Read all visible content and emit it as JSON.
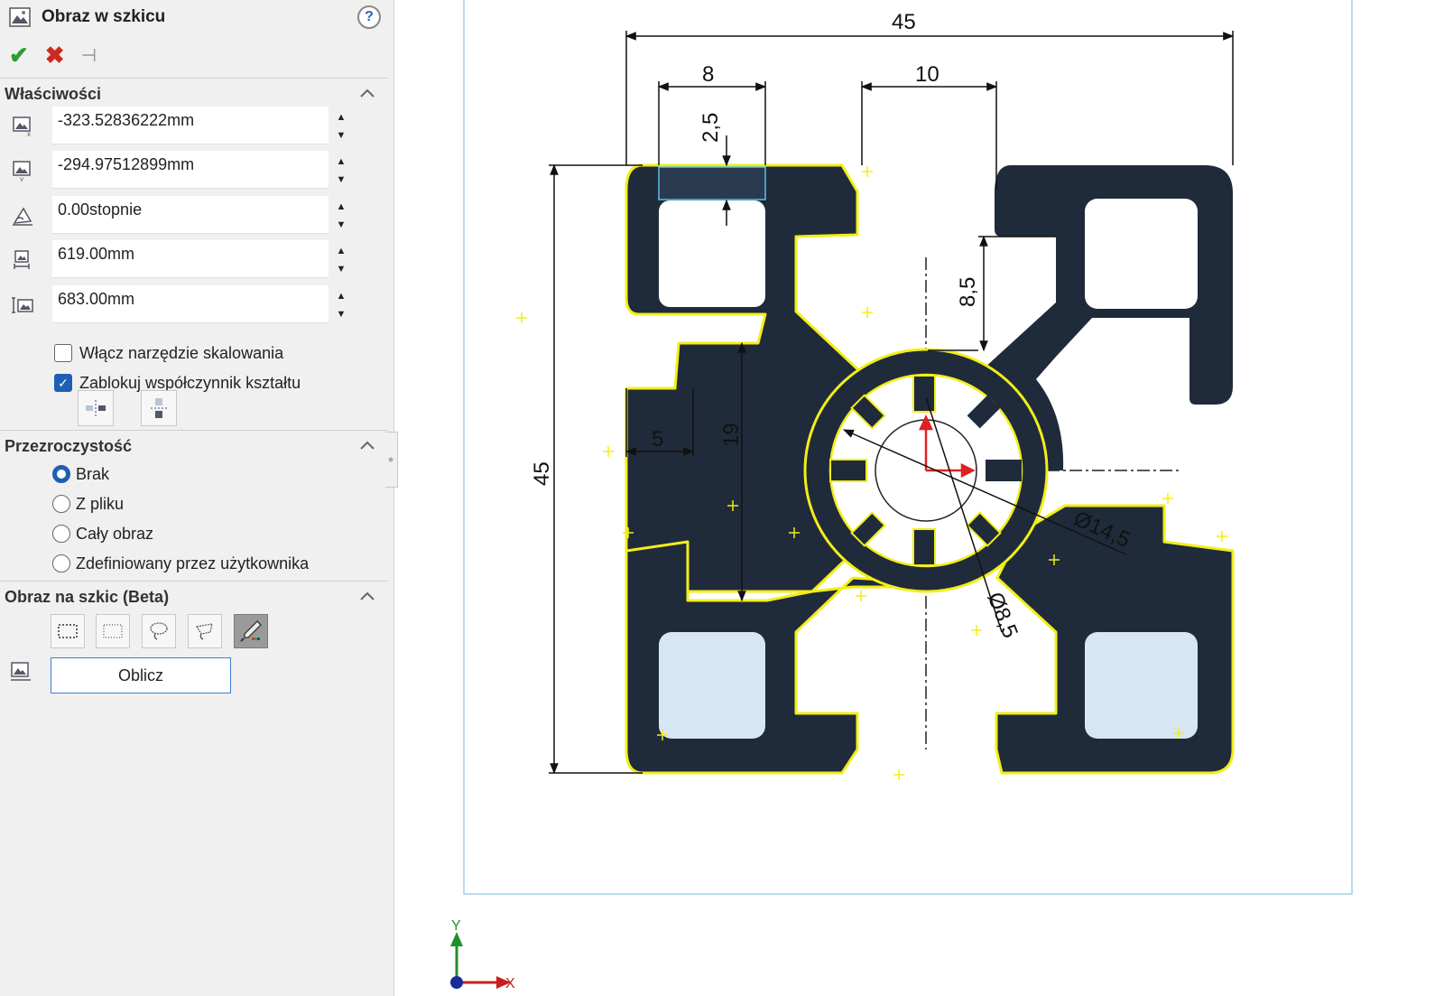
{
  "panel": {
    "title": "Obraz w szkicu",
    "help": "?",
    "sections": {
      "properties": "Właściwości",
      "transparency": "Przezroczystość",
      "image_to_sketch": "Obraz na szkic (Beta)"
    }
  },
  "properties": {
    "x_position": "-323.52836222mm",
    "y_position": "-294.97512899mm",
    "angle": "0.00stopnie",
    "width": "619.00mm",
    "height": "683.00mm",
    "enable_scale_tool": {
      "label": "Włącz narzędzie skalowania",
      "checked": false
    },
    "lock_aspect_ratio": {
      "label": "Zablokuj współczynnik kształtu",
      "checked": true
    }
  },
  "transparency": {
    "options": [
      "Brak",
      "Z pliku",
      "Cały obraz",
      "Zdefiniowany przez użytkownika"
    ],
    "selected": "Brak"
  },
  "image_to_sketch": {
    "tools": [
      "box-select-icon",
      "rect-select-icon",
      "lasso-icon",
      "poly-lasso-icon",
      "color-picker-icon"
    ],
    "active_tool": "color-picker-icon",
    "calculate_label": "Oblicz"
  },
  "drawing": {
    "dim_45_top": "45",
    "dim_8": "8",
    "dim_10": "10",
    "dim_2_5": "2,5",
    "dim_8_5": "8,5",
    "dim_45_left": "45",
    "dim_5": "5",
    "dim_19": "19",
    "dim_d14_5": "Ø14,5",
    "dim_d8_5": "Ø8,5"
  },
  "axes": {
    "x": "X",
    "y": "Y"
  },
  "colors": {
    "profile_fill": "#1f2b3a",
    "trace": "#f2ee18",
    "accent": "#1e5fb4",
    "pocket": "#d6e6f2"
  }
}
